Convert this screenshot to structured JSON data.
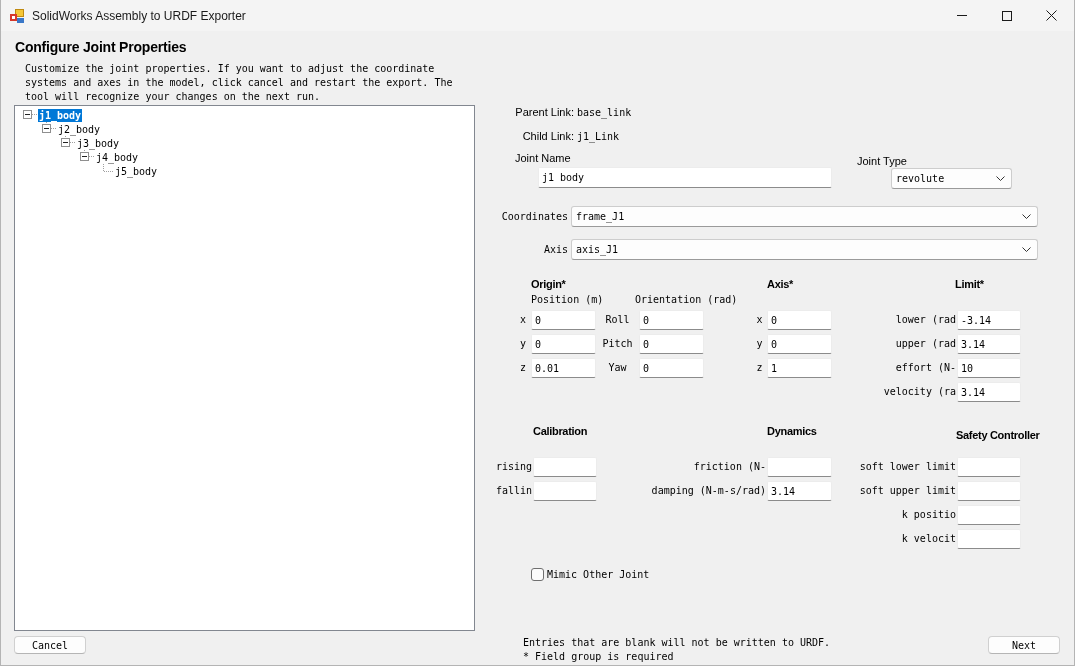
{
  "window": {
    "title": "SolidWorks Assembly to URDF Exporter"
  },
  "header": {
    "title": "Configure Joint Properties",
    "description": "Customize the joint properties. If you want to adjust the coordinate systems and axes in the model, click cancel and restart the export. The tool will recognize your changes on the next run."
  },
  "tree": {
    "nodes": [
      {
        "label": "j1_body",
        "selected": true,
        "expanded": true,
        "children": [
          {
            "label": "j2_body",
            "selected": false,
            "expanded": true,
            "children": [
              {
                "label": "j3_body",
                "selected": false,
                "expanded": true,
                "children": [
                  {
                    "label": "j4_body",
                    "selected": false,
                    "expanded": true,
                    "children": [
                      {
                        "label": "j5_body",
                        "selected": false
                      }
                    ]
                  }
                ]
              }
            ]
          }
        ]
      }
    ]
  },
  "links": [
    {
      "label": "Parent Link:",
      "value": "base_link"
    },
    {
      "label": "Child Link:",
      "value": "j1_Link"
    }
  ],
  "joint_name": {
    "label": "Joint Name",
    "value": "j1_body"
  },
  "joint_type": {
    "label": "Joint Type",
    "value": "revolute"
  },
  "coordinates": {
    "label": "Coordinates",
    "value": "frame_J1"
  },
  "axis_select": {
    "label": "Axis",
    "value": "axis_J1"
  },
  "origin": {
    "title": "Origin*",
    "position_heading": "Position (m)",
    "orientation_heading": "Orientation (rad)",
    "position": [
      {
        "label": "x",
        "value": "0"
      },
      {
        "label": "y",
        "value": "0"
      },
      {
        "label": "z",
        "value": "0.01"
      }
    ],
    "orientation": [
      {
        "label": "Roll",
        "value": "0"
      },
      {
        "label": "Pitch",
        "value": "0"
      },
      {
        "label": "Yaw",
        "value": "0"
      }
    ]
  },
  "axis": {
    "title": "Axis*",
    "fields": [
      {
        "label": "x",
        "value": "0"
      },
      {
        "label": "y",
        "value": "0"
      },
      {
        "label": "z",
        "value": "1"
      }
    ]
  },
  "limit": {
    "title": "Limit*",
    "fields": [
      {
        "label": "lower (rad",
        "value": "-3.14"
      },
      {
        "label": "upper (rad",
        "value": "3.14"
      },
      {
        "label": "effort (N-",
        "value": "10"
      },
      {
        "label": "velocity (ra",
        "value": "3.14"
      }
    ]
  },
  "calibration": {
    "title": "Calibration",
    "fields": [
      {
        "label": "rising"
      },
      {
        "label": "fallin"
      }
    ]
  },
  "dynamics": {
    "title": "Dynamics",
    "fields": [
      {
        "label": "friction (N-"
      },
      {
        "label": "damping (N-m-s/rad)",
        "value": "3.14"
      }
    ]
  },
  "safety_controller": {
    "title": "Safety Controller",
    "fields": [
      {
        "label": "soft lower limit"
      },
      {
        "label": "soft upper limit"
      },
      {
        "label": "k positio"
      },
      {
        "label": "k velocit"
      }
    ]
  },
  "mimic": {
    "label": "Mimic Other Joint",
    "checked": false
  },
  "footer": {
    "cancel_button": "Cancel",
    "notes": [
      "Entries that are blank will not be written to URDF.",
      "* Field group is required"
    ],
    "next_button": "Next"
  }
}
